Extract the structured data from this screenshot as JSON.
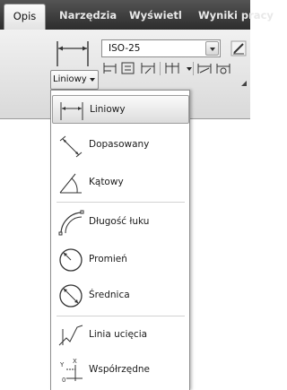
{
  "tabs": [
    {
      "label": "Opis",
      "active": true
    },
    {
      "label": "Narzędzia",
      "active": false
    },
    {
      "label": "Wyświetl",
      "active": false
    },
    {
      "label": "Wyniki pracy",
      "active": false
    }
  ],
  "dimension_panel": {
    "style_combo_value": "ISO-25",
    "dimension_button_label": "Liniowy",
    "big_icon": "linear-dimension-icon",
    "small_tools": [
      "baseline-dimension-icon",
      "dimension-space-icon",
      "dimension-break-icon",
      "continue-dimension-icon",
      "dimension-inspect-icon",
      "dimension-reassociate-icon"
    ]
  },
  "menu": {
    "items": [
      {
        "label": "Liniowy",
        "icon": "linear-dimension-icon",
        "selected": true
      },
      {
        "label": "Dopasowany",
        "icon": "aligned-dimension-icon",
        "selected": false
      },
      {
        "label": "Kątowy",
        "icon": "angular-dimension-icon",
        "selected": false
      },
      {
        "label": "Długość łuku",
        "icon": "arc-length-icon",
        "selected": false
      },
      {
        "label": "Promień",
        "icon": "radius-icon",
        "selected": false
      },
      {
        "label": "Średnica",
        "icon": "diameter-icon",
        "selected": false
      },
      {
        "label": "Linia ucięcia",
        "icon": "jogged-line-icon",
        "selected": false
      },
      {
        "label": "Współrzędne",
        "icon": "ordinate-icon",
        "selected": false
      }
    ]
  }
}
